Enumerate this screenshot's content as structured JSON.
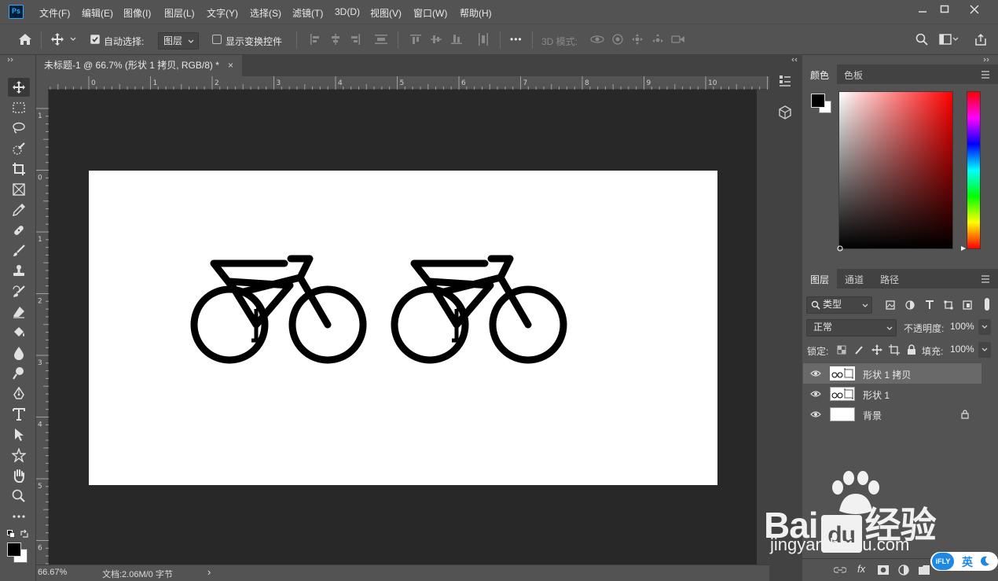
{
  "menubar": {
    "items": [
      "文件(F)",
      "编辑(E)",
      "图像(I)",
      "图层(L)",
      "文字(Y)",
      "选择(S)",
      "滤镜(T)",
      "3D(D)",
      "视图(V)",
      "窗口(W)",
      "帮助(H)"
    ],
    "logo": "Ps"
  },
  "optionsbar": {
    "auto_select_label": "自动选择:",
    "auto_select_value": "图层",
    "show_transform_label": "显示变换控件",
    "mode_3d_label": "3D 模式:",
    "more_label": "•••"
  },
  "document": {
    "tab_title": "未标题-1 @ 66.7% (形状 1 拷贝, RGB/8) *",
    "tab_close": "×",
    "ruler_top": [
      "0",
      "1",
      "2",
      "3",
      "4",
      "5",
      "6",
      "7",
      "8",
      "9",
      "10"
    ],
    "ruler_left": [
      "1",
      "0",
      "1",
      "2",
      "3",
      "4",
      "5",
      "6"
    ]
  },
  "statusbar": {
    "zoom": "66.67%",
    "doc_info": "文档:2.06M/0 字节",
    "arrow": "›"
  },
  "color_panel": {
    "tabs": [
      "颜色",
      "色板"
    ],
    "foreground": "#000000",
    "background": "#ffffff"
  },
  "layers_panel": {
    "tabs": [
      "图层",
      "通道",
      "路径"
    ],
    "filter_label": "类型",
    "blend_mode": "正常",
    "opacity_label": "不透明度:",
    "opacity_value": "100%",
    "lock_label": "锁定:",
    "fill_label": "填充:",
    "fill_value": "100%",
    "layers": [
      {
        "name": "形状 1 拷贝",
        "selected": true
      },
      {
        "name": "形状 1",
        "selected": false
      },
      {
        "name": "背景",
        "selected": false
      }
    ],
    "footer_fx": "fx"
  },
  "watermark": {
    "brand": "Bai 经验",
    "du": "du",
    "url": "jingyan.baidu.com"
  },
  "ime": {
    "logo": "iFLY",
    "lang": "英"
  },
  "colors": {
    "chrome": "#535353",
    "canvas_bg": "#282828",
    "accent_ps": "#31a8ff"
  }
}
